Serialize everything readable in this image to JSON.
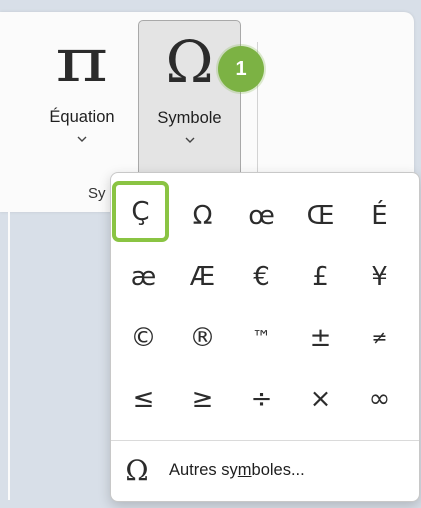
{
  "ribbon": {
    "equation": {
      "glyph": "π",
      "label": "Équation"
    },
    "symbol": {
      "glyph": "Ω",
      "label": "Symbole"
    },
    "group_label": "Sy"
  },
  "badge": {
    "number": "1",
    "color": "#7cb244"
  },
  "dropdown": {
    "symbols": [
      "Ç",
      "Ω",
      "œ",
      "Œ",
      "É",
      "æ",
      "Æ",
      "€",
      "£",
      "¥",
      "©",
      "®",
      "™",
      "±",
      "≠",
      "≤",
      "≥",
      "÷",
      "×",
      "∞"
    ],
    "selected": "Ç",
    "more_icon": "Ω",
    "more_label_pre": "Autres sy",
    "more_label_underlined": "m",
    "more_label_post": "boles..."
  },
  "colors": {
    "highlight": "#8ac443",
    "selected_button_bg": "#e4e4e4"
  }
}
